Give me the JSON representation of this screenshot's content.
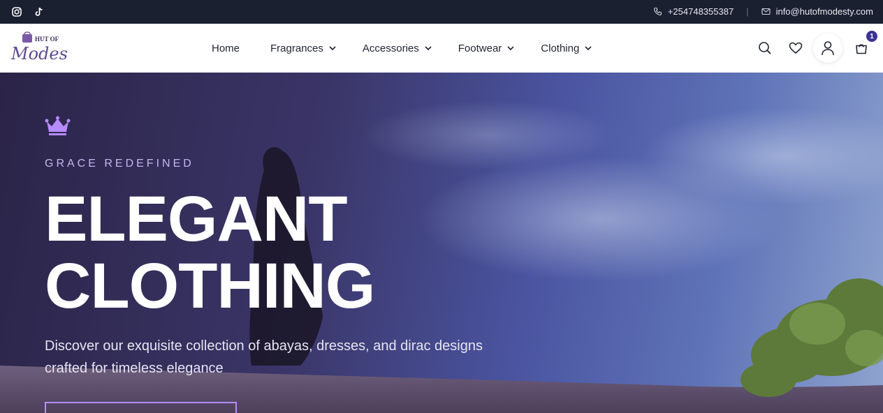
{
  "topbar": {
    "social": [
      {
        "name": "instagram-icon"
      },
      {
        "name": "tiktok-icon"
      }
    ],
    "phone": "+254748355387",
    "email": "info@hutofmodesty.com"
  },
  "nav": {
    "logo_alt": "Hut of Modesty",
    "items": [
      {
        "label": "Home",
        "dropdown": false
      },
      {
        "label": "Fragrances",
        "dropdown": true
      },
      {
        "label": "Accessories",
        "dropdown": true
      },
      {
        "label": "Footwear",
        "dropdown": true
      },
      {
        "label": "Clothing",
        "dropdown": true
      }
    ],
    "cart_count": "1"
  },
  "hero": {
    "tagline": "GRACE REDEFINED",
    "headline_line1": "ELEGANT",
    "headline_line2": "CLOTHING",
    "subtext": "Discover our exquisite collection of abayas, dresses, and dirac designs crafted for timeless elegance"
  },
  "colors": {
    "topbar": "#1b2031",
    "accent": "#b68cff",
    "badge": "#3a3393"
  }
}
